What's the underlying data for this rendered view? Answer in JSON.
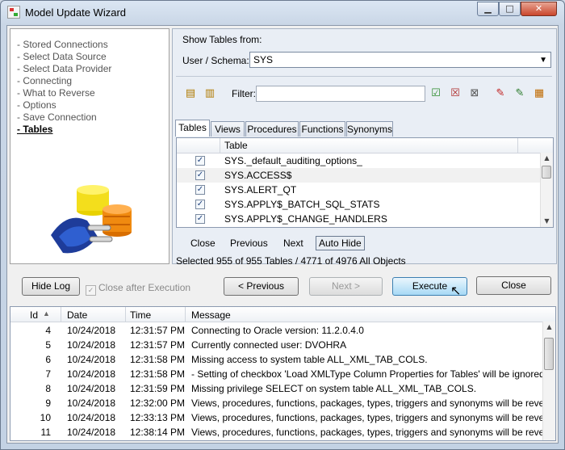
{
  "window": {
    "title": "Model Update Wizard"
  },
  "nav": {
    "items": [
      {
        "label": "- Stored Connections",
        "active": false
      },
      {
        "label": "- Select Data Source",
        "active": false
      },
      {
        "label": "- Select Data Provider",
        "active": false
      },
      {
        "label": "- Connecting",
        "active": false
      },
      {
        "label": "- What to Reverse",
        "active": false
      },
      {
        "label": "- Options",
        "active": false
      },
      {
        "label": "- Save Connection",
        "active": false
      },
      {
        "label": "- Tables",
        "active": true
      }
    ]
  },
  "main": {
    "show_tables_label": "Show Tables from:",
    "schema_label": "User / Schema:",
    "schema_value": "SYS",
    "filter_label": "Filter:",
    "filter_value": "",
    "tabs": [
      "Tables",
      "Views",
      "Procedures",
      "Functions",
      "Synonyms"
    ],
    "active_tab": "Tables",
    "grid_header": "Table",
    "tables": [
      {
        "name": "SYS._default_auditing_options_",
        "checked": true
      },
      {
        "name": "SYS.ACCESS$",
        "checked": true
      },
      {
        "name": "SYS.ALERT_QT",
        "checked": true
      },
      {
        "name": "SYS.APPLY$_BATCH_SQL_STATS",
        "checked": true
      },
      {
        "name": "SYS.APPLY$_CHANGE_HANDLERS",
        "checked": true
      }
    ],
    "grid_buttons": {
      "close": "Close",
      "previous": "Previous",
      "next": "Next",
      "auto_hide": "Auto Hide"
    },
    "status": "Selected 955 of 955 Tables / 4771 of 4976 All Objects"
  },
  "actions": {
    "hide_log": "Hide Log",
    "close_after_execution": "Close after Execution",
    "close_after_execution_checked": true,
    "previous": "< Previous",
    "next": "Next >",
    "execute": "Execute",
    "close": "Close"
  },
  "log": {
    "columns": [
      "Id",
      "Date",
      "Time",
      "Message"
    ],
    "rows": [
      {
        "id": "4",
        "date": "10/24/2018",
        "time": "12:31:57 PM",
        "message": "Connecting to Oracle version: 11.2.0.4.0"
      },
      {
        "id": "5",
        "date": "10/24/2018",
        "time": "12:31:57 PM",
        "message": "Currently connected user: DVOHRA"
      },
      {
        "id": "6",
        "date": "10/24/2018",
        "time": "12:31:58 PM",
        "message": "Missing access to system table ALL_XML_TAB_COLS."
      },
      {
        "id": "7",
        "date": "10/24/2018",
        "time": "12:31:58 PM",
        "message": " - Setting of checkbox 'Load XMLType Column Properties for Tables' will be ignored."
      },
      {
        "id": "8",
        "date": "10/24/2018",
        "time": "12:31:59 PM",
        "message": "Missing privilege SELECT on system table ALL_XML_TAB_COLS."
      },
      {
        "id": "9",
        "date": "10/24/2018",
        "time": "12:32:00 PM",
        "message": "Views, procedures, functions, packages, types, triggers and synonyms will be reversed from e"
      },
      {
        "id": "10",
        "date": "10/24/2018",
        "time": "12:33:13 PM",
        "message": "Views, procedures, functions, packages, types, triggers and synonyms will be reversed from e"
      },
      {
        "id": "11",
        "date": "10/24/2018",
        "time": "12:38:14 PM",
        "message": "Views, procedures, functions, packages, types, triggers and synonyms will be reversed from e"
      }
    ]
  }
}
